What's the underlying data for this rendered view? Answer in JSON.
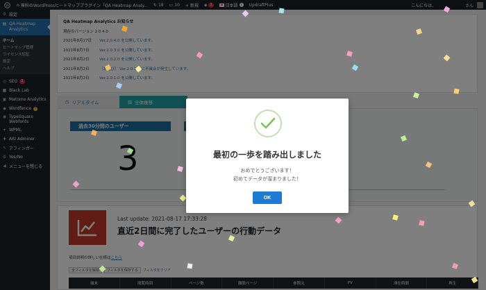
{
  "adminbar": {
    "site_name": "無料のWordPressヒートマッププラグイン「QA Heatmap Analy...",
    "update_count": "18",
    "comment_count": "10",
    "new_label": "+ 新規",
    "badge_count": "1",
    "lang_label": "日本語",
    "plugin_label": "UpdraftPlus",
    "greeting": "こんにちは、",
    "user_suffix": "さん"
  },
  "sidebar": {
    "top_item": "設定",
    "active_item": "QA Heatmap Analytics",
    "submenu": [
      "ホーム",
      "ヒートマップ管理",
      "ライセンス認証",
      "設定",
      "ヘルプ"
    ],
    "items": [
      {
        "icon": "seo-icon",
        "label": "SEO",
        "badge": "1"
      },
      {
        "icon": "blacklab-icon",
        "label": "Black Lab",
        "badge": ""
      },
      {
        "icon": "matomo-icon",
        "label": "Matomo Analytics",
        "badge": ""
      },
      {
        "icon": "wordfence-icon",
        "label": "Wordfence",
        "badge": "!"
      },
      {
        "icon": "typesquare-icon",
        "label": "TypeSquare Webfonts",
        "badge": ""
      },
      {
        "icon": "wpml-icon",
        "label": "WPML",
        "badge": ""
      },
      {
        "icon": "ari-icon",
        "label": "ARI Adminer",
        "badge": ""
      },
      {
        "icon": "affinger-icon",
        "label": "アフィンガー",
        "badge": ""
      },
      {
        "icon": "yesno-icon",
        "label": "Yes/No",
        "badge": ""
      },
      {
        "icon": "collapse-icon",
        "label": "メニューを閉じる",
        "badge": ""
      }
    ]
  },
  "notice": {
    "title": "QA Heatmap Analytics お知らせ",
    "current_version": "現在のバージョン 2.0.4.0",
    "news": [
      {
        "date": "2021年8月17日",
        "text": "Ver.2.0.4.0 を公開しています。"
      },
      {
        "date": "2021年8月7日",
        "text": "Ver.2.0.3.0 を公開しています。"
      },
      {
        "date": "2021年8月2日",
        "text": "Ver.2.0.2.0 を公開しています。"
      },
      {
        "date": "2021年8月2日",
        "text": "［お詫び］ Ver.2.0.1.0 に不具合が発生しています。"
      },
      {
        "date": "2021年8月2日",
        "text": "Ver.2.0.1.0 を公開しています。"
      }
    ]
  },
  "tabs": [
    {
      "label": "リアルタイム"
    },
    {
      "label": "全体推移"
    }
  ],
  "realtime": {
    "visitors_label": "過去30分間のユーザー",
    "visitors_value": "3"
  },
  "card": {
    "last_update": "Last update: 2021-08-17 17:33:28",
    "headline": "直近2日間に完了したユーザーの行動データ",
    "hint_prefix": "項目説明の詳しい仕様は",
    "hint_link": "こちら",
    "filter1": "全フィルタを解除",
    "filter2": "フィルタを保存する",
    "filter3": "フィルタをクリア",
    "columns": [
      "端末",
      "閲覧時刻",
      "ページ数",
      "離脱ページ",
      "参照元",
      "PV",
      "滞在時間",
      "再生"
    ]
  },
  "modal": {
    "title": "最初の一歩を踏み出しました",
    "line1": "おめでとうございます！",
    "line2": "初めてデータが溜まりました！",
    "ok_label": "OK"
  },
  "colors": {
    "accent_blue": "#2271b1",
    "teal_tab": "#20a3a3",
    "ok_button": "#1e7bd3",
    "report_icon_bg": "#c0392b",
    "check_green": "#7cc159"
  }
}
